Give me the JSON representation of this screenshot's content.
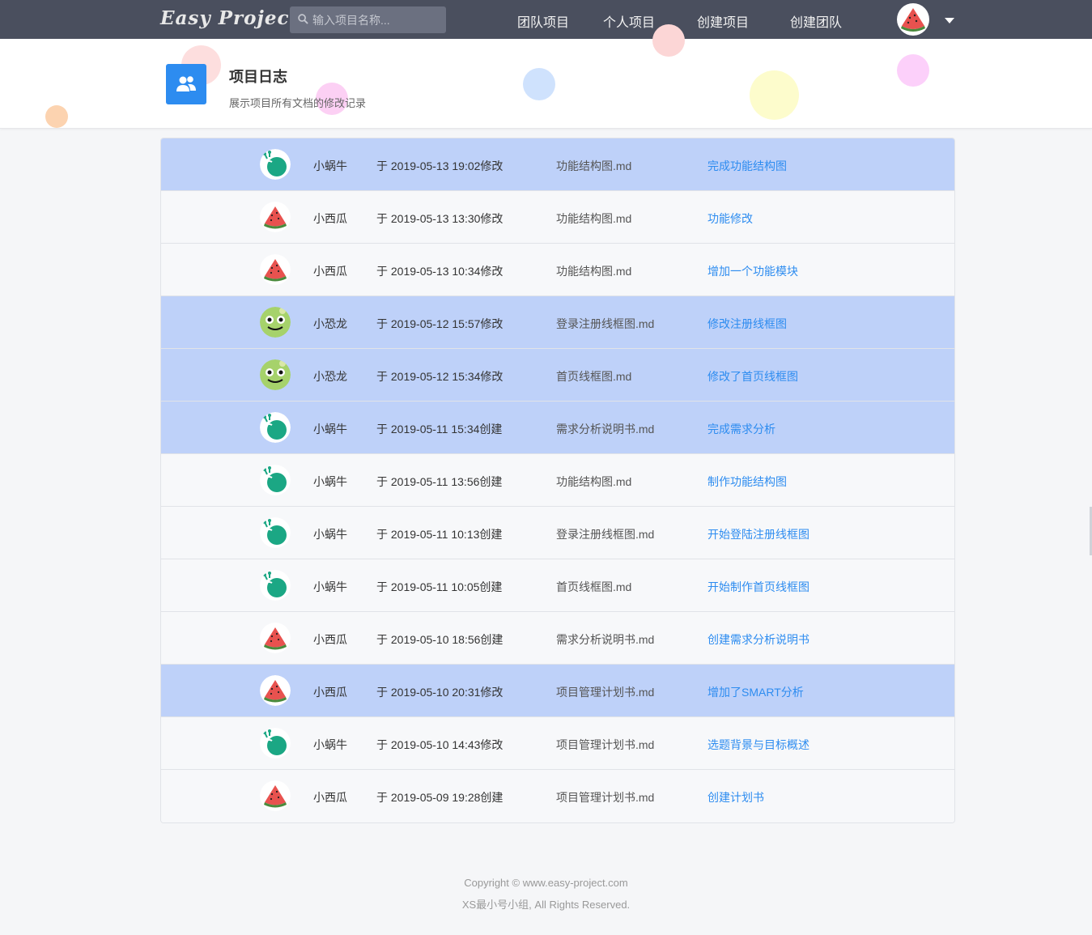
{
  "navbar": {
    "brand": "Easy Project",
    "search_placeholder": "输入项目名称...",
    "items": [
      "团队项目",
      "个人项目",
      "创建项目",
      "创建团队"
    ]
  },
  "header": {
    "title": "项目日志",
    "subtitle": "展示项目所有文档的修改记录"
  },
  "colors": {
    "navbar": "#4a4f5e",
    "highlight_row": "#bed1f9",
    "link": "#2d8cf0",
    "accent_icon": "#2d8cf0"
  },
  "logs": [
    {
      "avatar": "snail-avatar-icon",
      "user": "小蜗牛",
      "time": "于 2019-05-13 19:02修改",
      "file": "功能结构图.md",
      "note": "完成功能结构图",
      "highlight": true
    },
    {
      "avatar": "watermelon-avatar-icon",
      "user": "小西瓜",
      "time": "于 2019-05-13 13:30修改",
      "file": "功能结构图.md",
      "note": "功能修改",
      "highlight": false
    },
    {
      "avatar": "watermelon-avatar-icon",
      "user": "小西瓜",
      "time": "于 2019-05-13 10:34修改",
      "file": "功能结构图.md",
      "note": "增加一个功能模块",
      "highlight": false
    },
    {
      "avatar": "dinosaur-avatar-icon",
      "user": "小恐龙",
      "time": "于 2019-05-12 15:57修改",
      "file": "登录注册线框图.md",
      "note": "修改注册线框图",
      "highlight": true
    },
    {
      "avatar": "dinosaur-avatar-icon",
      "user": "小恐龙",
      "time": "于 2019-05-12 15:34修改",
      "file": "首页线框图.md",
      "note": "修改了首页线框图",
      "highlight": true
    },
    {
      "avatar": "snail-avatar-icon",
      "user": "小蜗牛",
      "time": "于 2019-05-11 15:34创建",
      "file": "需求分析说明书.md",
      "note": "完成需求分析",
      "highlight": true
    },
    {
      "avatar": "snail-avatar-icon",
      "user": "小蜗牛",
      "time": "于 2019-05-11 13:56创建",
      "file": "功能结构图.md",
      "note": "制作功能结构图",
      "highlight": false
    },
    {
      "avatar": "snail-avatar-icon",
      "user": "小蜗牛",
      "time": "于 2019-05-11 10:13创建",
      "file": "登录注册线框图.md",
      "note": "开始登陆注册线框图",
      "highlight": false
    },
    {
      "avatar": "snail-avatar-icon",
      "user": "小蜗牛",
      "time": "于 2019-05-11 10:05创建",
      "file": "首页线框图.md",
      "note": "开始制作首页线框图",
      "highlight": false
    },
    {
      "avatar": "watermelon-avatar-icon",
      "user": "小西瓜",
      "time": "于 2019-05-10 18:56创建",
      "file": "需求分析说明书.md",
      "note": "创建需求分析说明书",
      "highlight": false
    },
    {
      "avatar": "watermelon-avatar-icon",
      "user": "小西瓜",
      "time": "于 2019-05-10 20:31修改",
      "file": "项目管理计划书.md",
      "note": "增加了SMART分析",
      "highlight": true
    },
    {
      "avatar": "snail-avatar-icon",
      "user": "小蜗牛",
      "time": "于 2019-05-10 14:43修改",
      "file": "项目管理计划书.md",
      "note": "选题背景与目标概述",
      "highlight": false
    },
    {
      "avatar": "watermelon-avatar-icon",
      "user": "小西瓜",
      "time": "于 2019-05-09 19:28创建",
      "file": "项目管理计划书.md",
      "note": "创建计划书",
      "highlight": false
    }
  ],
  "footer": {
    "line1": "Copyright © www.easy-project.com",
    "line2": "XS最小号小组, All Rights Reserved."
  }
}
